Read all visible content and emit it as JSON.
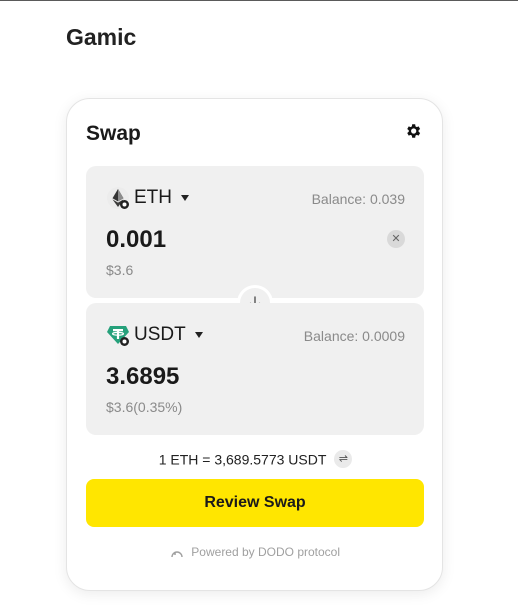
{
  "app": {
    "title": "Gamic"
  },
  "swap": {
    "title": "Swap",
    "from": {
      "token": "ETH",
      "icon": "ethereum-icon",
      "balance": "Balance: 0.039",
      "amount": "0.001",
      "usd": "$3.6"
    },
    "to": {
      "token": "USDT",
      "icon": "tether-icon",
      "balance": "Balance: 0.0009",
      "amount": "3.6895",
      "usd": "$3.6(0.35%)"
    },
    "rate": "1 ETH = 3,689.5773 USDT",
    "review_label": "Review Swap",
    "powered_by": "Powered by DODO protocol"
  },
  "colors": {
    "accent": "#ffe600",
    "panel": "#f0f0f0",
    "tether": "#26a17b"
  }
}
